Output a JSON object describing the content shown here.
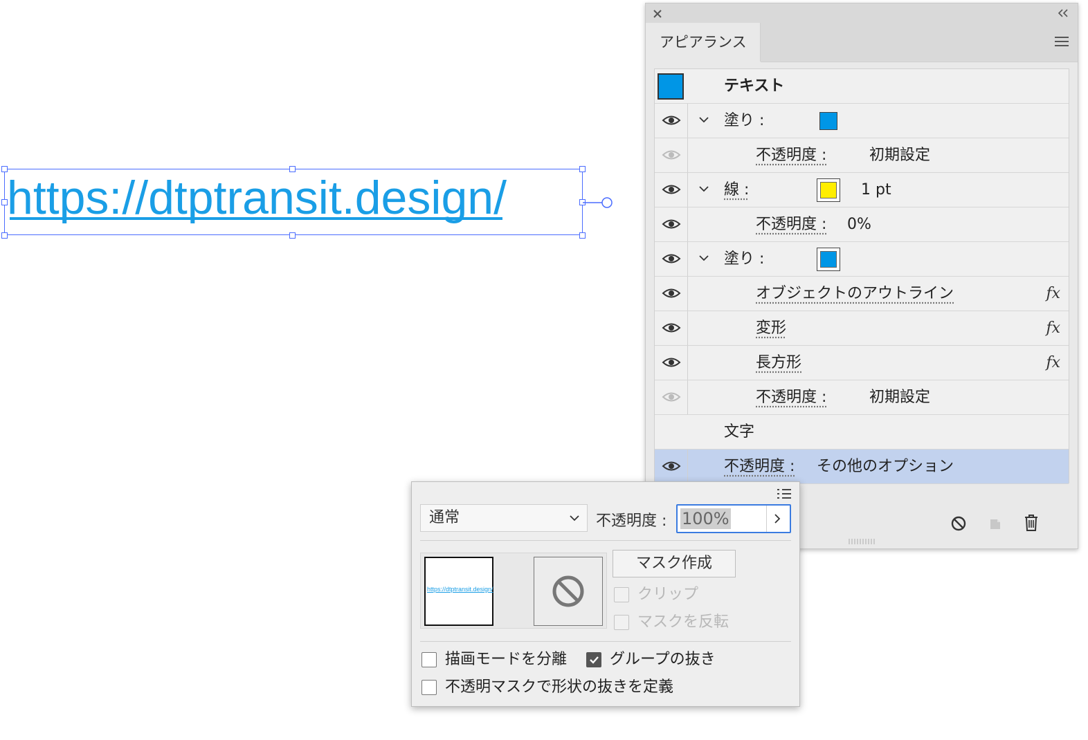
{
  "canvas": {
    "text": "https://dtptransit.design/"
  },
  "panel": {
    "tab_label": "アピアランス",
    "rows": [
      {
        "label": "テキスト"
      },
      {
        "label": "塗り :"
      },
      {
        "label": "不透明度 :",
        "value": "初期設定"
      },
      {
        "label": "線 :",
        "value": "1 pt"
      },
      {
        "label": "不透明度 :",
        "value": "0%"
      },
      {
        "label": "塗り :"
      },
      {
        "label": "オブジェクトのアウトライン",
        "fx": "fx"
      },
      {
        "label": "変形",
        "fx": "fx"
      },
      {
        "label": "長方形",
        "fx": "fx"
      },
      {
        "label": "不透明度 :",
        "value": "初期設定"
      },
      {
        "label": "文字"
      },
      {
        "label": "不透明度 :",
        "value": "その他のオプション"
      }
    ],
    "colors": {
      "fill": "#0096e6",
      "stroke": "#ffee00",
      "selected_row": "#c2d2ee"
    }
  },
  "popup": {
    "blend_mode": "通常",
    "opacity_label": "不透明度 :",
    "opacity_value": "100%",
    "thumb_text": "https://dtptransit.design/",
    "make_mask_label": "マスク作成",
    "clip_label": "クリップ",
    "invert_mask_label": "マスクを反転",
    "isolate_label": "描画モードを分離",
    "knockout_label": "グループの抜き",
    "opacity_mask_label": "不透明マスクで形状の抜きを定義",
    "knockout_checked": true
  }
}
